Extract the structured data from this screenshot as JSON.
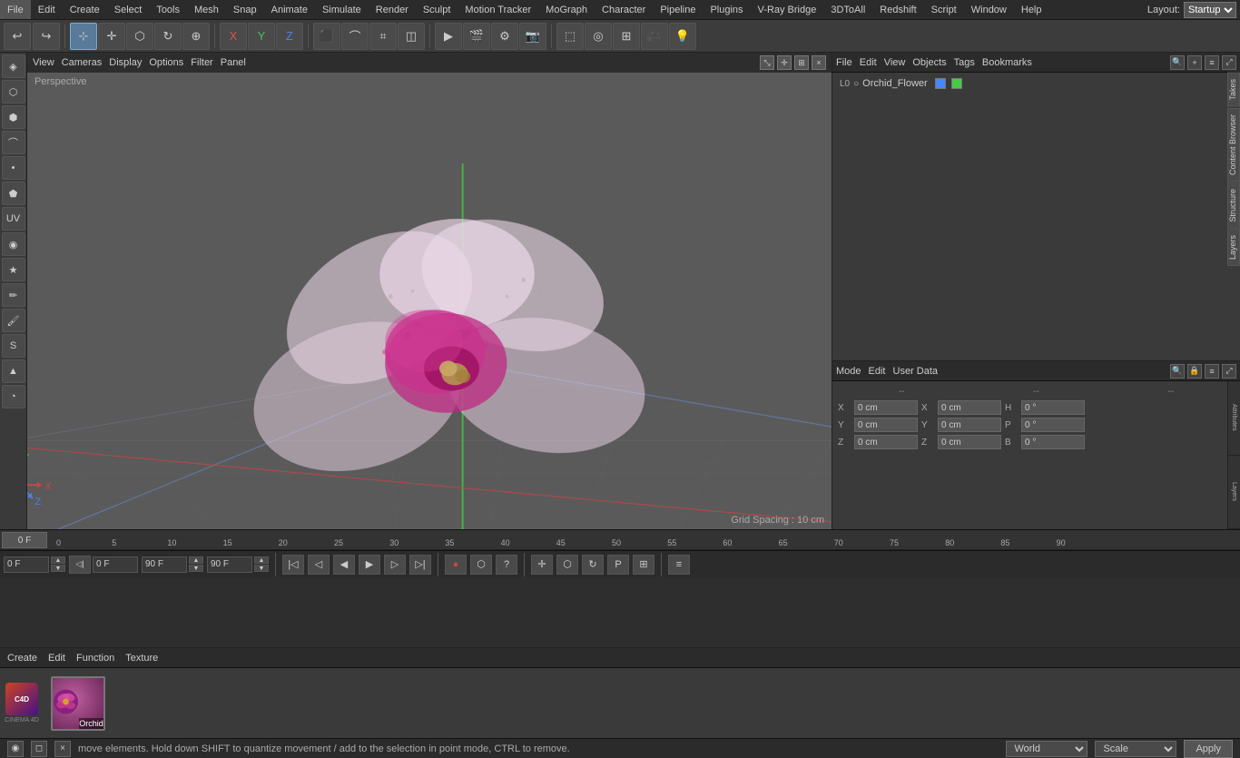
{
  "app": {
    "title": "Cinema 4D"
  },
  "menu": {
    "items": [
      "File",
      "Edit",
      "Create",
      "Select",
      "Tools",
      "Mesh",
      "Snap",
      "Animate",
      "Simulate",
      "Render",
      "Sculpt",
      "Motion Tracker",
      "MoGraph",
      "Character",
      "Pipeline",
      "Plugins",
      "V-Ray Bridge",
      "3DToAll",
      "Redshift",
      "Script",
      "Window",
      "Help"
    ]
  },
  "layout": {
    "label": "Layout:",
    "value": "Startup"
  },
  "toolbar": {
    "undo_icon": "↩",
    "redo_icon": "↪"
  },
  "viewport": {
    "menus": [
      "View",
      "Cameras",
      "Display",
      "Options",
      "Filter",
      "Panel"
    ],
    "perspective_label": "Perspective",
    "grid_spacing": "Grid Spacing : 10 cm"
  },
  "right_panel": {
    "header_menus": [
      "File",
      "Edit",
      "View",
      "Objects",
      "Tags",
      "Bookmarks"
    ],
    "object_name": "Orchid_Flower",
    "side_tabs": [
      "Takes",
      "Content Browser",
      "Structure",
      "Layers"
    ],
    "attributes_header": [
      "Mode",
      "Edit",
      "User Data"
    ]
  },
  "timeline": {
    "start_frame": "0 F",
    "end_frame": "90 F",
    "current_frame": "0 F",
    "preview_start": "0 F",
    "preview_end": "90 F",
    "ticks": [
      "0",
      "5",
      "10",
      "15",
      "20",
      "25",
      "30",
      "35",
      "40",
      "45",
      "50",
      "55",
      "60",
      "65",
      "70",
      "75",
      "80",
      "85",
      "90"
    ],
    "current_frame_display": "0 F"
  },
  "bottom_panel": {
    "menus": [
      "Create",
      "Edit",
      "Function",
      "Texture"
    ],
    "material_name": "Orchid"
  },
  "attributes": {
    "x_pos_label": "X",
    "y_pos_label": "Y",
    "z_pos_label": "Z",
    "x_pos_val": "0 cm",
    "y_pos_val": "0 cm",
    "z_pos_val": "0 cm",
    "x_rot_label": "X",
    "y_rot_label": "Y",
    "z_rot_label": "Z",
    "x_rot_val": "0 °",
    "y_rot_val": "0 °",
    "z_rot_val": "0 °",
    "h_label": "H",
    "p_label": "P",
    "b_label": "B",
    "h_val": "0 °",
    "p_val": "0 °",
    "b_val": "0 °",
    "x_size_label": "X",
    "y_size_label": "Y",
    "z_size_label": "Z",
    "x_size_val": "0 cm",
    "y_size_val": "0 cm",
    "z_size_val": "0 cm",
    "col1_dash": "--",
    "col2_dash": "--",
    "col3_dash": "--"
  },
  "status": {
    "text": "move elements. Hold down SHIFT to quantize movement / add to the selection in point mode, CTRL to remove.",
    "world_label": "World",
    "scale_label": "Scale",
    "apply_label": "Apply"
  }
}
